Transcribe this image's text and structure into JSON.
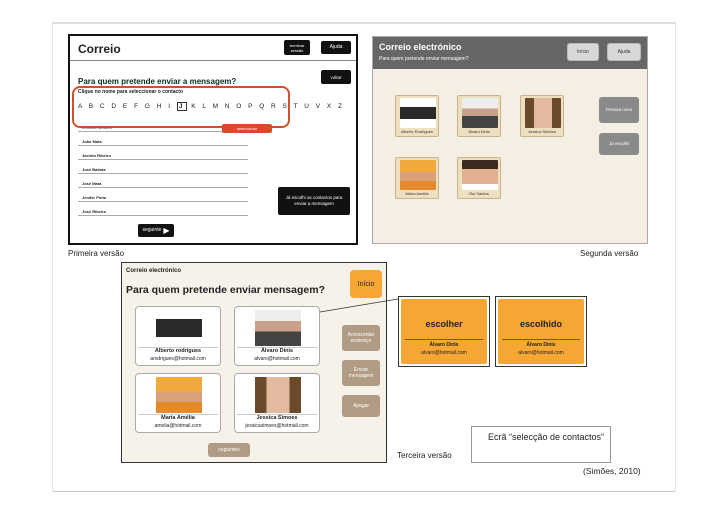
{
  "captions": {
    "v1": "Primeira versão",
    "v2": "Segunda versão",
    "v3": "Terceira versão",
    "source": "(Simões, 2010)",
    "callout": "Ecrã “selecção de contactos”"
  },
  "v1": {
    "title": "Correio",
    "terminar": "terminar sessão",
    "ajuda": "Ajuda",
    "voltar": "voltar",
    "question": "Para quem pretende enviar a mensagem?",
    "instruction": "Clique no nome para seleccionar o contacto",
    "alphabet_before": "A B C D E F G H I",
    "alphabet_selected": "J",
    "alphabet_after": "K L M N O P Q R S T U V X Z",
    "selected_row": "Jessica Simoes",
    "seleccionar": "seleccionar",
    "contacts": [
      "João Mata",
      "Jacinto Ribeiro",
      "José Batista",
      "José Mata",
      "Jenifer Pinto",
      "José Ribeiro"
    ],
    "done_btn": "Já escolhi os contactos para enviar a mensagem",
    "seguinte": "seguinte"
  },
  "v2": {
    "title": "Correio electrónico",
    "subtitle": "Para quem pretende enviar mensagem?",
    "inicio": "Início",
    "ajuda": "Ajuda",
    "pessoa_nova": "Pessoa nova",
    "ja_escolhi": "Já escolhi",
    "contacts": [
      "Alberto Rodrigues",
      "Álvaro Dinis",
      "Jessica Simões",
      "Maria Amélia",
      "Rui Santos"
    ]
  },
  "v3": {
    "title": "Correio electrónico",
    "question": "Para quem pretende enviar mensagem?",
    "inicio": "Início",
    "acrescentar": "Acrescentar endereço",
    "enviar": "Enviar mensagem",
    "apagar": "Apagar",
    "seguintes": "seguintes",
    "contacts": [
      {
        "name": "Alberto rodrigues",
        "email": "arodrigues@hotmail.com"
      },
      {
        "name": "Álvaro Dinis",
        "email": "alvaro@hotmail.com"
      },
      {
        "name": "Maria Amélia",
        "email": "amelia@hotmail.com"
      },
      {
        "name": "Jessica Simoes",
        "email": "jessicasimoes@hotmail.com"
      }
    ],
    "state_cards": [
      {
        "label": "escolher",
        "name": "Álvaro Dinis",
        "email": "alvaro@hotmail.com"
      },
      {
        "label": "escolhido",
        "name": "Álvaro Dinis",
        "email": "alvaro@hotmail.com"
      }
    ]
  },
  "colors": {
    "orange": "#f6a633",
    "red_highlight": "#d1502a",
    "v2_header": "#666666",
    "v3_side_button": "#b09b85"
  }
}
